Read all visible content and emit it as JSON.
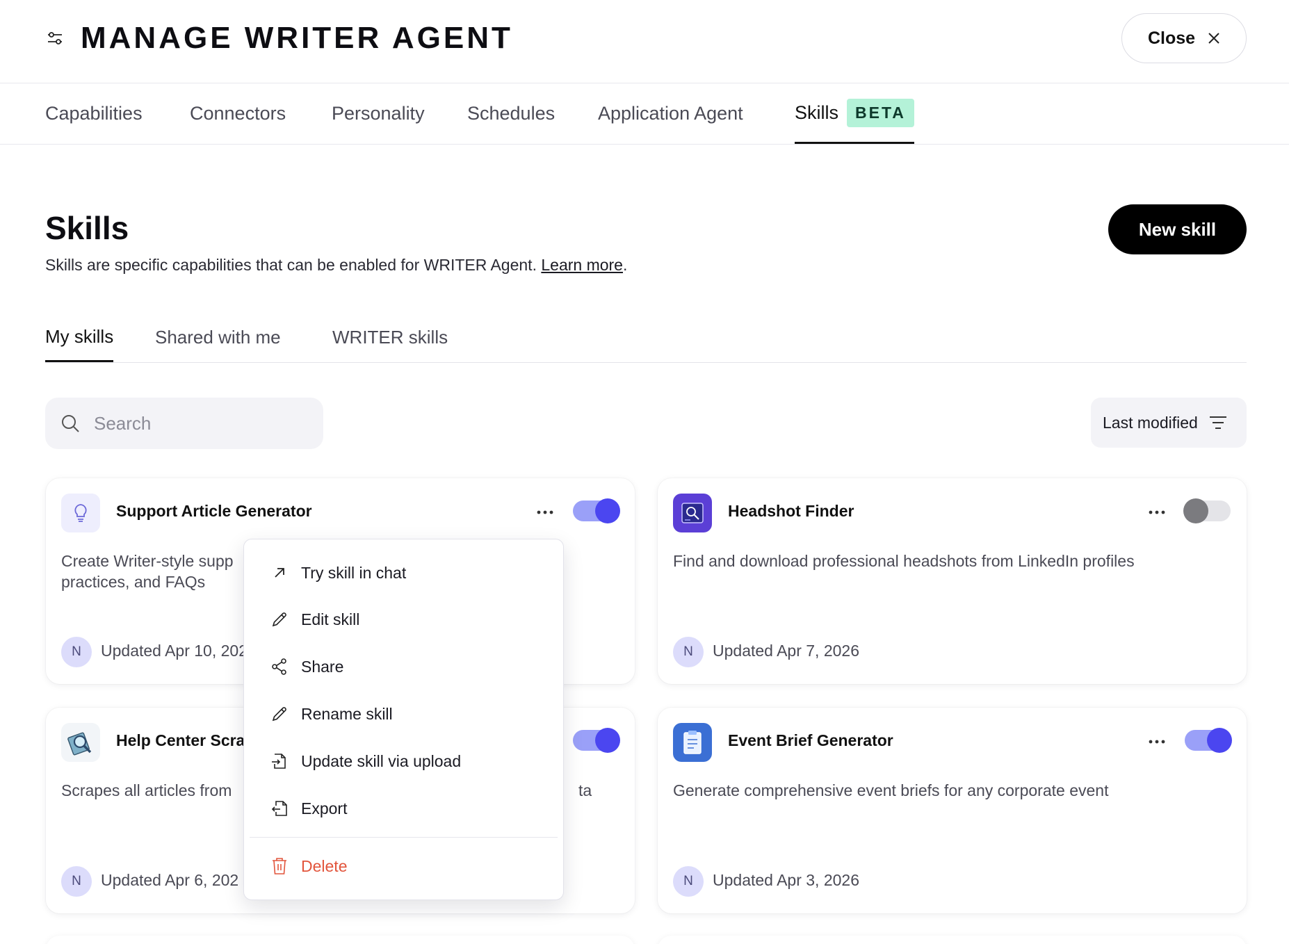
{
  "header": {
    "title": "MANAGE WRITER AGENT",
    "close_label": "Close"
  },
  "top_tabs": [
    {
      "label": "Capabilities"
    },
    {
      "label": "Connectors"
    },
    {
      "label": "Personality"
    },
    {
      "label": "Schedules"
    },
    {
      "label": "Application Agent"
    },
    {
      "label": "Skills",
      "badge": "BETA",
      "active": true
    }
  ],
  "section": {
    "title": "Skills",
    "description": "Skills are specific capabilities that can be enabled for WRITER Agent.",
    "learn_more": "Learn more",
    "period": ".",
    "new_skill_label": "New skill"
  },
  "sub_tabs": [
    {
      "label": "My skills",
      "active": true
    },
    {
      "label": "Shared with me"
    },
    {
      "label": "WRITER skills"
    }
  ],
  "search": {
    "placeholder": "Search"
  },
  "sort": {
    "label": "Last modified"
  },
  "cards": [
    {
      "title": "Support Article Generator",
      "description": "Create Writer-style supp",
      "description_line2": "practices, and FAQs",
      "avatar": "N",
      "updated": "Updated Apr 10, 202",
      "enabled": true,
      "icon": "lightbulb-icon"
    },
    {
      "title": "Headshot Finder",
      "description": "Find and download professional headshots from LinkedIn profiles",
      "avatar": "N",
      "updated": "Updated Apr 7, 2026",
      "enabled": false,
      "icon": "id-card-search-icon"
    },
    {
      "title": "Help Center Scra",
      "description": "Scrapes all articles from",
      "description_tail": "ta",
      "avatar": "N",
      "updated": "Updated Apr 6, 202",
      "enabled": true,
      "icon": "magnifier-book-icon"
    },
    {
      "title": "Event Brief Generator",
      "description": "Generate comprehensive event briefs for any corporate event",
      "avatar": "N",
      "updated": "Updated Apr 3, 2026",
      "enabled": true,
      "icon": "clipboard-icon"
    }
  ],
  "menu": {
    "items": [
      {
        "label": "Try skill in chat",
        "icon": "arrow-up-right-icon"
      },
      {
        "label": "Edit skill",
        "icon": "pencil-icon"
      },
      {
        "label": "Share",
        "icon": "share-icon"
      },
      {
        "label": "Rename skill",
        "icon": "pencil-icon"
      },
      {
        "label": "Update skill via upload",
        "icon": "file-upload-icon"
      },
      {
        "label": "Export",
        "icon": "file-export-icon"
      }
    ],
    "delete_label": "Delete"
  },
  "colors": {
    "accent": "#4b46f0",
    "toggle_on_track": "#9aa0f8",
    "beta_badge": "#b4f2d8",
    "danger": "#e2553c"
  }
}
